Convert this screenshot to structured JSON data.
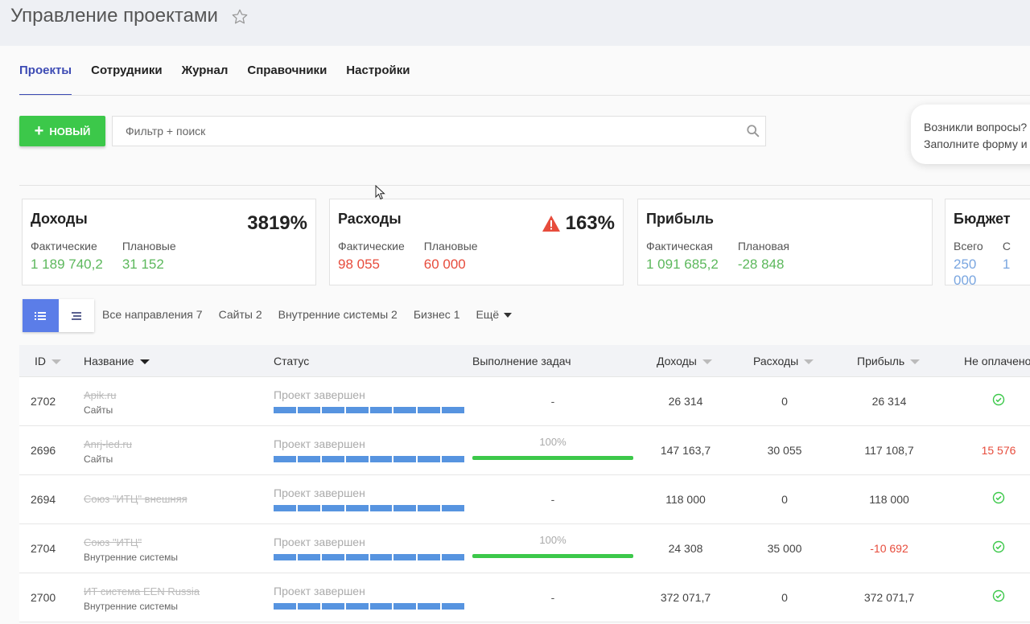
{
  "header": {
    "title": "Управление проектами"
  },
  "tabs": [
    "Проекты",
    "Сотрудники",
    "Журнал",
    "Справочники",
    "Настройки"
  ],
  "toolbar": {
    "new_label": "НОВЫЙ",
    "search_placeholder": "Фильтр + поиск"
  },
  "help": {
    "line1": "Возникли вопросы?",
    "line2": "Заполните форму и"
  },
  "cards": {
    "income": {
      "title": "Доходы",
      "pct": "3819%",
      "l1": "Фактические",
      "v1": "1 189 740,2",
      "l2": "Плановые",
      "v2": "31 152"
    },
    "expenses": {
      "title": "Расходы",
      "pct": "163%",
      "l1": "Фактические",
      "v1": "98 055",
      "l2": "Плановые",
      "v2": "60 000"
    },
    "profit": {
      "title": "Прибыль",
      "l1": "Фактическая",
      "v1": "1 091 685,2",
      "l2": "Плановая",
      "v2": "-28 848"
    },
    "budget": {
      "title": "Бюджет",
      "l1": "Всего",
      "v1": "250 000",
      "l2": "С",
      "v2": "1"
    }
  },
  "filters": [
    "Все направления 7",
    "Сайты 2",
    "Внутренние системы 2",
    "Бизнес 1",
    "Ещё"
  ],
  "table": {
    "headers": {
      "id": "ID",
      "name": "Название",
      "status": "Статус",
      "exec": "Выполнение задач",
      "income": "Доходы",
      "expenses": "Расходы",
      "profit": "Прибыль",
      "unpaid": "Не оплачено"
    },
    "rows": [
      {
        "id": "2702",
        "name": "Apik.ru",
        "sub": "Сайты",
        "status": "Проект завершен",
        "exec": "-",
        "income": "26 314",
        "expenses": "0",
        "profit": "26 314",
        "unpaid": ""
      },
      {
        "id": "2696",
        "name": "Anrj-led.ru",
        "sub": "Сайты",
        "status": "Проект завершен",
        "exec": "100%",
        "income": "147 163,7",
        "expenses": "30 055",
        "profit": "117 108,7",
        "unpaid": "15 576"
      },
      {
        "id": "2694",
        "name": "Союз \"ИТЦ\" внешняя",
        "sub": "",
        "status": "Проект завершен",
        "exec": "-",
        "income": "118 000",
        "expenses": "0",
        "profit": "118 000",
        "unpaid": ""
      },
      {
        "id": "2704",
        "name": "Союз \"ИТЦ\"",
        "sub": "Внутренние системы",
        "status": "Проект завершен",
        "exec": "100%",
        "income": "24 308",
        "expenses": "35 000",
        "profit": "-10 692",
        "unpaid": ""
      },
      {
        "id": "2700",
        "name": "ИТ система EEN Russia",
        "sub": "Внутренние системы",
        "status": "Проект завершен",
        "exec": "-",
        "income": "372 071,7",
        "expenses": "0",
        "profit": "372 071,7",
        "unpaid": ""
      }
    ]
  },
  "colors": {
    "accent": "#3d4bb4",
    "green": "#3cc84a",
    "red": "#e74c3c",
    "blue": "#5794e0"
  }
}
